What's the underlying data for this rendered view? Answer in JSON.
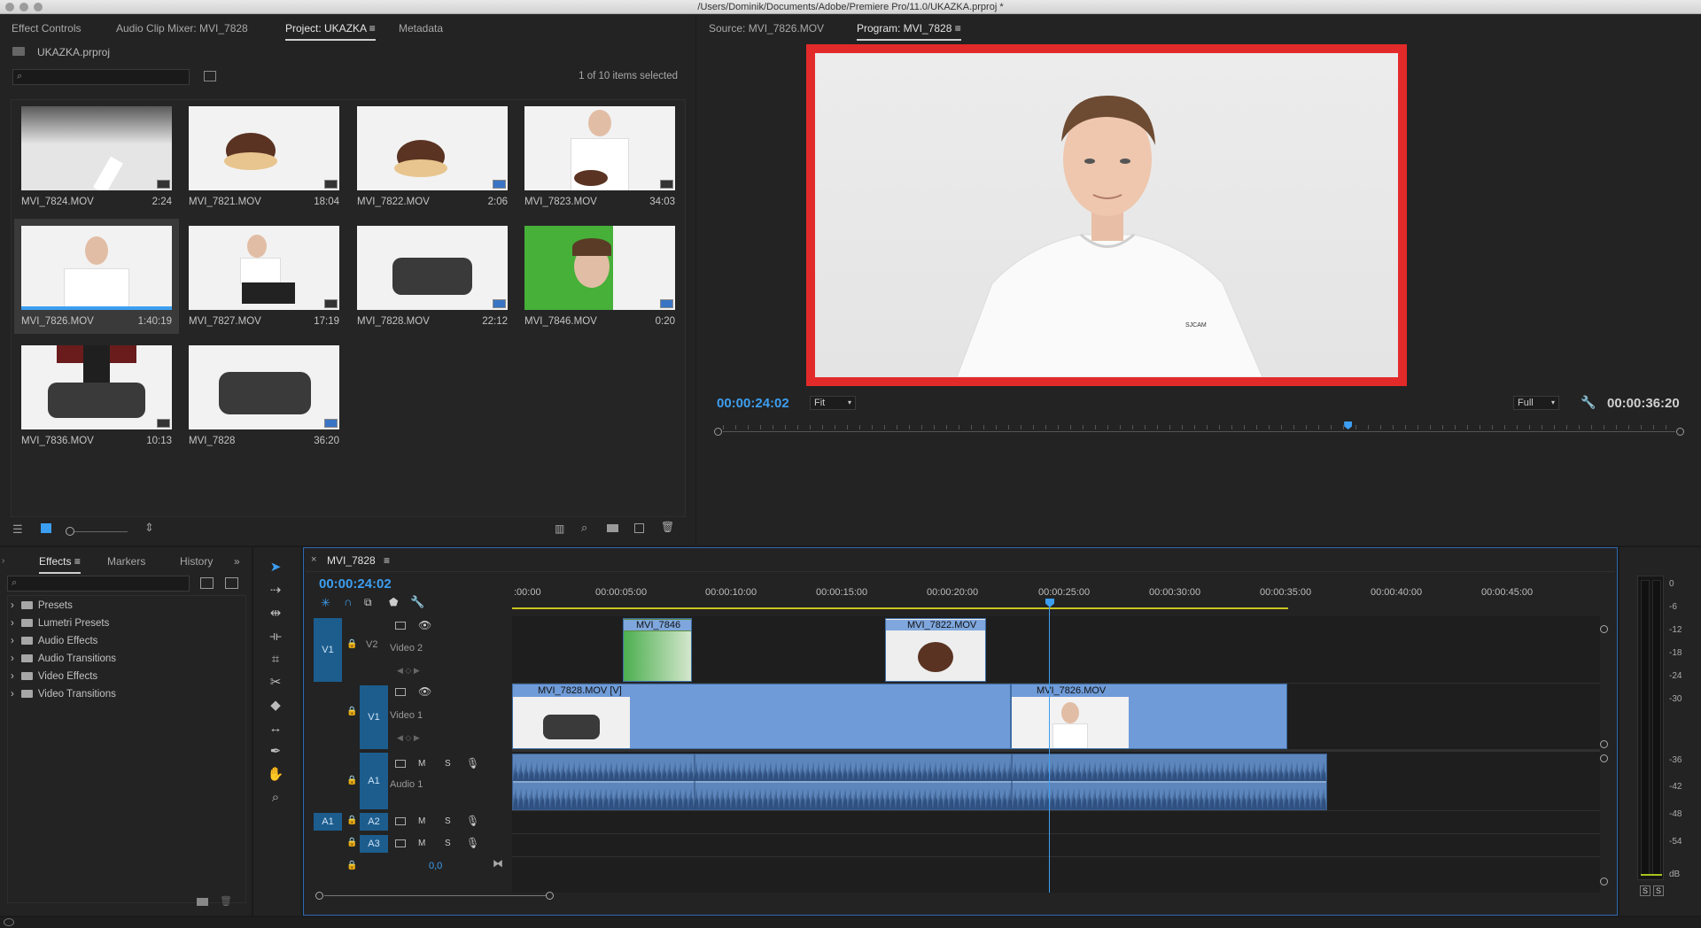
{
  "window": {
    "title": "/Users/Dominik/Documents/Adobe/Premiere Pro/11.0/UKAZKA.prproj *"
  },
  "left_top": {
    "tabs": [
      "Effect Controls",
      "Audio Clip Mixer: MVI_7828",
      "Project: UKAZKA",
      "Metadata"
    ],
    "project_file": "UKAZKA.prproj",
    "selection_status": "1 of 10 items selected",
    "items": [
      {
        "name": "MVI_7824.MOV",
        "duration": "2:24",
        "scene": "dark-top",
        "badge": "grey"
      },
      {
        "name": "MVI_7821.MOV",
        "duration": "18:04",
        "scene": "donut",
        "badge": "grey"
      },
      {
        "name": "MVI_7822.MOV",
        "duration": "2:06",
        "scene": "donut2",
        "badge": "blue"
      },
      {
        "name": "MVI_7823.MOV",
        "duration": "34:03",
        "scene": "person-donut",
        "badge": "grey"
      },
      {
        "name": "MVI_7826.MOV",
        "duration": "1:40:19",
        "scene": "person",
        "badge": "none",
        "selected": true
      },
      {
        "name": "MVI_7827.MOV",
        "duration": "17:19",
        "scene": "crouch",
        "badge": "grey"
      },
      {
        "name": "MVI_7828.MOV",
        "duration": "22:12",
        "scene": "dumbbell",
        "badge": "blue"
      },
      {
        "name": "MVI_7846.MOV",
        "duration": "0:20",
        "scene": "green",
        "badge": "blue"
      },
      {
        "name": "MVI_7836.MOV",
        "duration": "10:13",
        "scene": "legs",
        "badge": "grey"
      },
      {
        "name": "MVI_7828",
        "duration": "36:20",
        "scene": "dumbbell2",
        "badge": "blue"
      }
    ]
  },
  "monitor": {
    "tabs": [
      "Source: MVI_7826.MOV",
      "Program: MVI_7828"
    ],
    "timecode": "00:00:24:02",
    "fit": "Fit",
    "quality": "Full",
    "duration": "00:00:36:20",
    "playhead_fraction": 0.656,
    "shirt_logo": "SJCAM"
  },
  "effects_panel": {
    "tabs": [
      "Effects",
      "Markers",
      "History"
    ],
    "folders": [
      "Presets",
      "Lumetri Presets",
      "Audio Effects",
      "Audio Transitions",
      "Video Effects",
      "Video Transitions"
    ]
  },
  "timeline": {
    "sequence": "MVI_7828",
    "timecode": "00:00:24:02",
    "ruler": ":00:00",
    "ticks": [
      "00:00:05:00",
      "00:00:10:00",
      "00:00:15:00",
      "00:00:20:00",
      "00:00:25:00",
      "00:00:30:00",
      "00:00:35:00",
      "00:00:40:00",
      "00:00:45:00"
    ],
    "tracks": {
      "v2": {
        "src": "V1",
        "name": "V2",
        "label": "Video 2"
      },
      "v1": {
        "name": "V1",
        "label": "Video 1"
      },
      "a1": {
        "name": "A1",
        "label": "Audio 1",
        "m": "M",
        "s": "S"
      },
      "a2": {
        "src": "A1",
        "name": "A2",
        "m": "M",
        "s": "S"
      },
      "a3": {
        "name": "A3",
        "m": "M",
        "s": "S"
      }
    },
    "mix_value": "0,0",
    "clips": {
      "v2_a": "MVI_7846",
      "v2_b": "MVI_7822.MOV",
      "v1_a": "MVI_7828.MOV [V]",
      "v1_b": "MVI_7826.MOV"
    }
  },
  "meter": {
    "labels": [
      "0",
      "-6",
      "-12",
      "-18",
      "-24",
      "-30",
      "-36",
      "-42",
      "-48",
      "-54",
      "dB"
    ],
    "s1": "S",
    "s2": "S"
  }
}
